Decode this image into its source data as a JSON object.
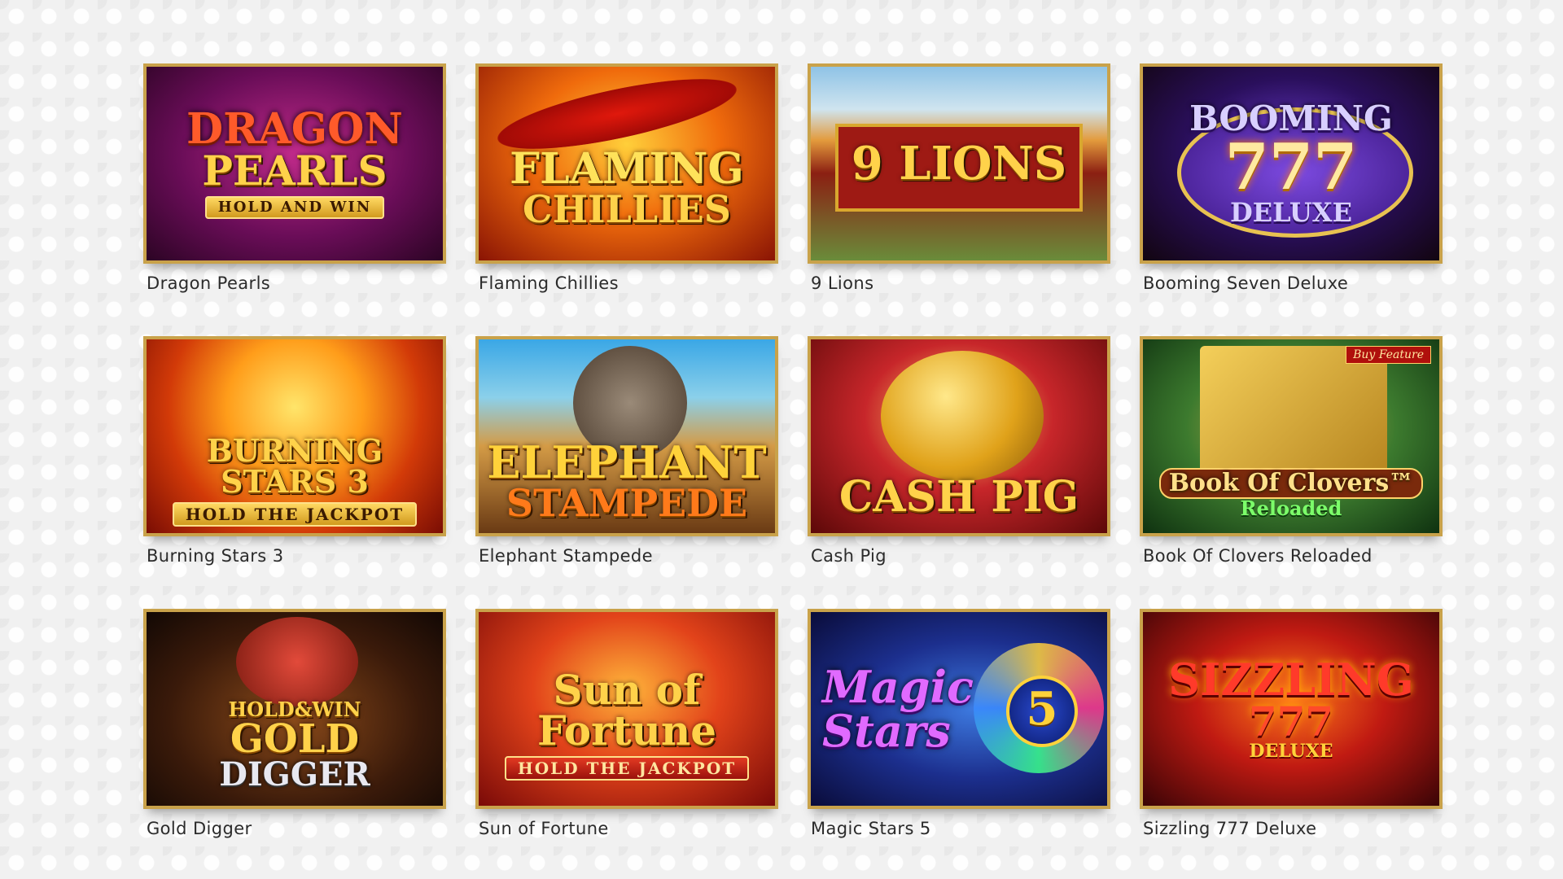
{
  "colors": {
    "frame_gold": "#c9a24a",
    "page_background": "#f1f1f1",
    "title_text": "#2b2b2b"
  },
  "games": [
    {
      "title": "Dragon Pearls",
      "art": {
        "line1": "DRAGON",
        "line2": "PEARLS",
        "tagline": "HOLD AND WIN"
      }
    },
    {
      "title": "Flaming Chillies",
      "art": {
        "line1": "FLAMING",
        "line2": "CHILLIES"
      }
    },
    {
      "title": "9 Lions",
      "art": {
        "line1": "9 LIONS"
      }
    },
    {
      "title": "Booming Seven Deluxe",
      "art": {
        "line1": "BOOMING",
        "line2": "777",
        "tagline": "DELUXE"
      }
    },
    {
      "title": "Burning Stars 3",
      "art": {
        "line1": "BURNING STARS 3",
        "tagline": "HOLD THE JACKPOT"
      }
    },
    {
      "title": "Elephant Stampede",
      "art": {
        "line1": "ELEPHANT",
        "line2": "STAMPEDE"
      }
    },
    {
      "title": "Cash Pig",
      "art": {
        "line1": "CASH PIG"
      }
    },
    {
      "title": "Book Of Clovers Reloaded",
      "art": {
        "corner_badge": "Buy Feature",
        "line1": "Book Of Clovers™",
        "line2": "Reloaded"
      }
    },
    {
      "title": "Gold Digger",
      "art": {
        "tagline": "HOLD&WIN",
        "line1": "GOLD",
        "line2": "DIGGER"
      }
    },
    {
      "title": "Sun of Fortune",
      "art": {
        "line1": "Sun of",
        "line2": "Fortune",
        "tagline": "HOLD THE JACKPOT"
      }
    },
    {
      "title": "Magic Stars 5",
      "art": {
        "line1": "Magic",
        "line2": "Stars",
        "number": "5"
      }
    },
    {
      "title": "Sizzling 777 Deluxe",
      "art": {
        "line1": "SIZZLING",
        "line2": "777",
        "tagline": "DELUXE"
      }
    }
  ]
}
